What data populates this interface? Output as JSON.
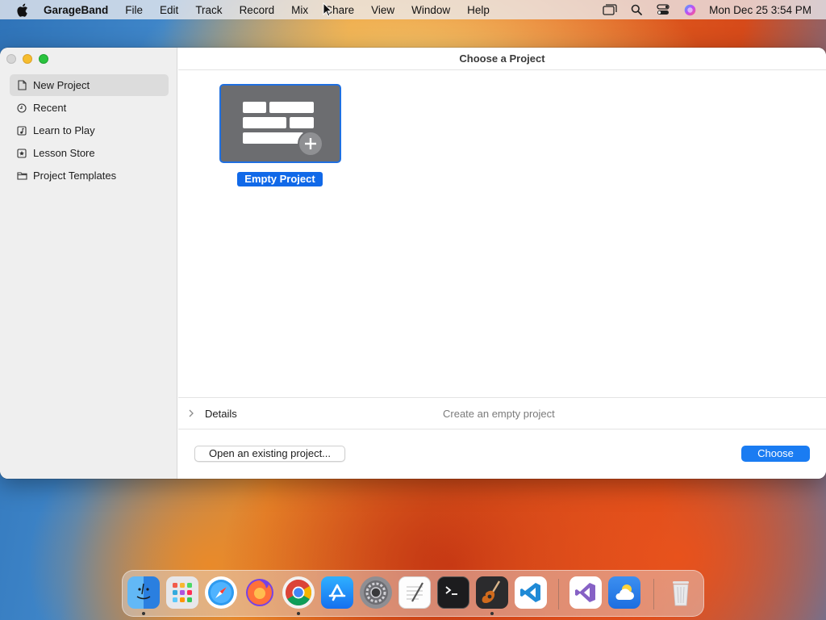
{
  "menubar": {
    "app_name": "GarageBand",
    "menus": [
      "File",
      "Edit",
      "Track",
      "Record",
      "Mix",
      "Share",
      "View",
      "Window",
      "Help"
    ],
    "clock": "Mon Dec 25  3:54 PM"
  },
  "window": {
    "title": "Choose a Project",
    "sidebar": {
      "items": [
        {
          "label": "New Project",
          "icon": "document-icon",
          "selected": true
        },
        {
          "label": "Recent",
          "icon": "clock-icon",
          "selected": false
        },
        {
          "label": "Learn to Play",
          "icon": "music-note-icon",
          "selected": false
        },
        {
          "label": "Lesson Store",
          "icon": "star-icon",
          "selected": false
        },
        {
          "label": "Project Templates",
          "icon": "folder-icon",
          "selected": false
        }
      ]
    },
    "project": {
      "label": "Empty Project"
    },
    "details": {
      "label": "Details",
      "description": "Create an empty project"
    },
    "buttons": {
      "open_existing": "Open an existing project...",
      "choose": "Choose"
    }
  },
  "dock": {
    "apps": [
      "Finder",
      "Launchpad",
      "Safari",
      "Firefox",
      "Chrome",
      "App Store",
      "System Settings",
      "TextEdit",
      "Terminal",
      "GarageBand",
      "Visual Studio Code",
      "Visual Studio",
      "Weather",
      "Trash"
    ],
    "running": [
      "Finder",
      "Chrome",
      "GarageBand"
    ]
  },
  "colors": {
    "accent": "#1a7cf2",
    "selection_label": "#1169e8"
  }
}
